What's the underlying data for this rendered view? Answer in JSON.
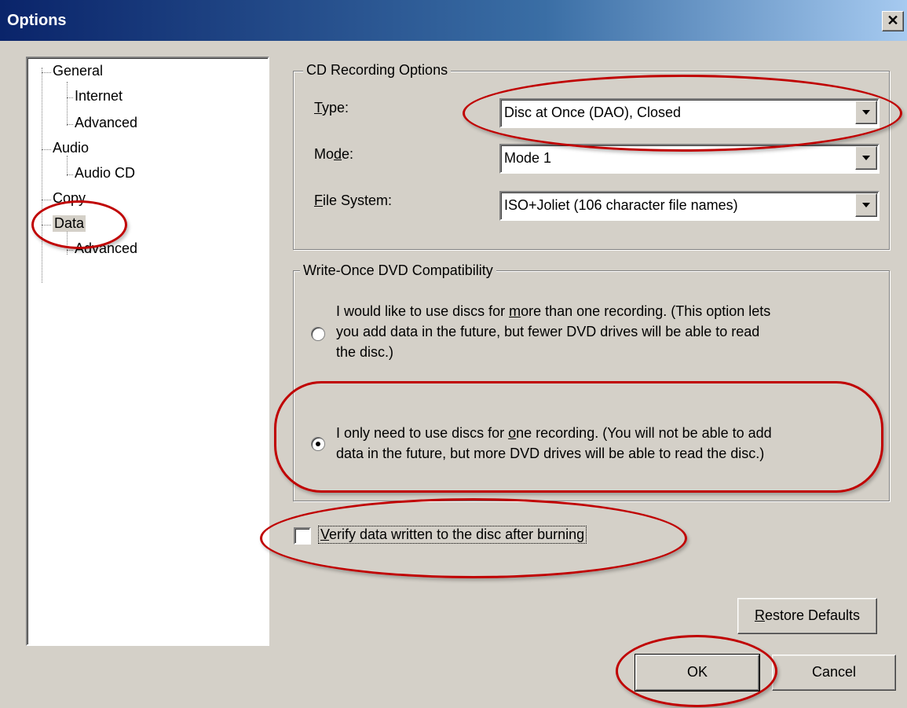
{
  "window": {
    "title": "Options",
    "close_symbol": "✕"
  },
  "tree": {
    "items": [
      {
        "label": "General"
      },
      {
        "label": "Internet"
      },
      {
        "label": "Advanced"
      },
      {
        "label": "Audio"
      },
      {
        "label": "Audio CD"
      },
      {
        "label": "Copy"
      },
      {
        "label": "Data"
      },
      {
        "label": "Advanced"
      }
    ],
    "selected": "Data"
  },
  "cd_options": {
    "group_label": "CD Recording Options",
    "type_label": {
      "mnemonic": "T",
      "rest": "ype:"
    },
    "type_value": "Disc at Once (DAO), Closed",
    "mode_label": {
      "before": "Mo",
      "mnemonic": "d",
      "after": "e:"
    },
    "mode_value": "Mode 1",
    "fs_label": {
      "mnemonic": "F",
      "rest": "ile System:"
    },
    "fs_value": "ISO+Joliet (106 character file names)"
  },
  "dvd": {
    "group_label": "Write-Once DVD Compatibility",
    "option1": {
      "line1_before": "I would like to use discs for ",
      "line1_mnemonic": "m",
      "line1_after": "ore than one recording. (This option lets",
      "line2": "you add data in the future, but fewer DVD drives will be able to read",
      "line3": "the disc.)",
      "checked": false
    },
    "option2": {
      "line1_before": "I only need to use discs for ",
      "line1_mnemonic": "o",
      "line1_after": "ne recording. (You will not be able to add",
      "line2": "data in the future, but more DVD drives will be able to read the disc.)",
      "checked": true
    }
  },
  "verify": {
    "mnemonic": "V",
    "rest": "erify data written to the disc after burning",
    "checked": false
  },
  "buttons": {
    "restore_mnemonic": "R",
    "restore_rest": "estore Defaults",
    "ok": "OK",
    "cancel": "Cancel"
  },
  "annotation_color": "#c00000"
}
